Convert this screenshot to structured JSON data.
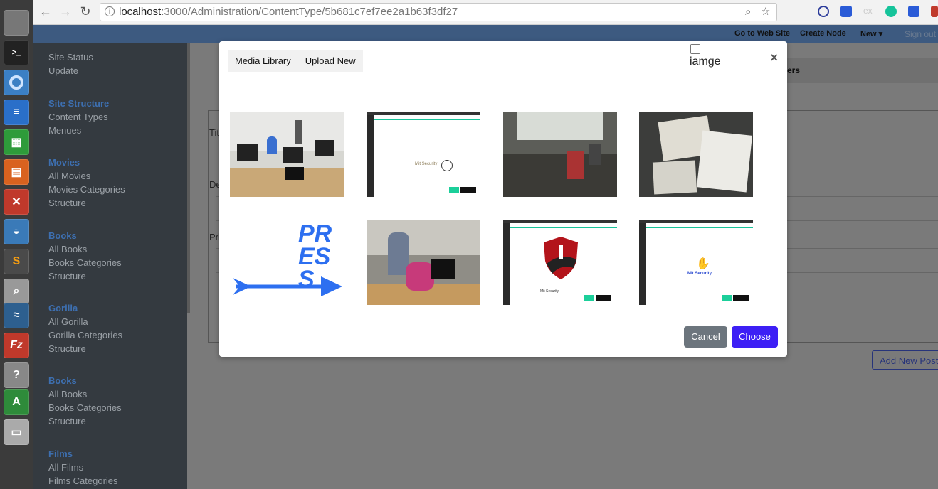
{
  "browser": {
    "url_host": "localhost",
    "url_path": ":3000/Administration/ContentType/5b681c7ef7ee2a1b63f3df27"
  },
  "appbar": {
    "go_to_site": "Go to Web Site",
    "create_node": "Create Node",
    "new": "New ▾",
    "sign_out": "Sign out"
  },
  "sidebar": {
    "groups": [
      {
        "head": "",
        "items": [
          "Site Status",
          "Update"
        ]
      },
      {
        "head": "Site Structure",
        "items": [
          "Content Types",
          "Menues"
        ]
      },
      {
        "head": "Movies",
        "items": [
          "All Movies",
          "Movies Categories",
          "Structure"
        ]
      },
      {
        "head": "Books",
        "items": [
          "All Books",
          "Books Categories",
          "Structure"
        ]
      },
      {
        "head": "Gorilla",
        "items": [
          "All Gorilla",
          "Gorilla Categories",
          "Structure"
        ]
      },
      {
        "head": "Books",
        "items": [
          "All Books",
          "Books Categories",
          "Structure"
        ]
      },
      {
        "head": "Films",
        "items": [
          "All Films",
          "Films Categories"
        ]
      }
    ]
  },
  "main": {
    "header_fragment": "ers",
    "labels": [
      "Tit",
      "De",
      "Pri"
    ],
    "add_new_post": "Add New Post"
  },
  "modal": {
    "tab_media_library": "Media Library",
    "tab_upload_new": "Upload New",
    "checkbox_label": "iamge",
    "close": "×",
    "cancel": "Cancel",
    "choose": "Choose",
    "thumb_texts": {
      "press": "PRESS",
      "security": "Mit Security"
    }
  },
  "colors": {
    "sidebar_bg": "#343a40",
    "sidebar_head": "#3d6fb0",
    "appbar_bg": "#3d5a80",
    "cancel_bg": "#6c757d",
    "choose_bg": "#3d1ff5"
  }
}
